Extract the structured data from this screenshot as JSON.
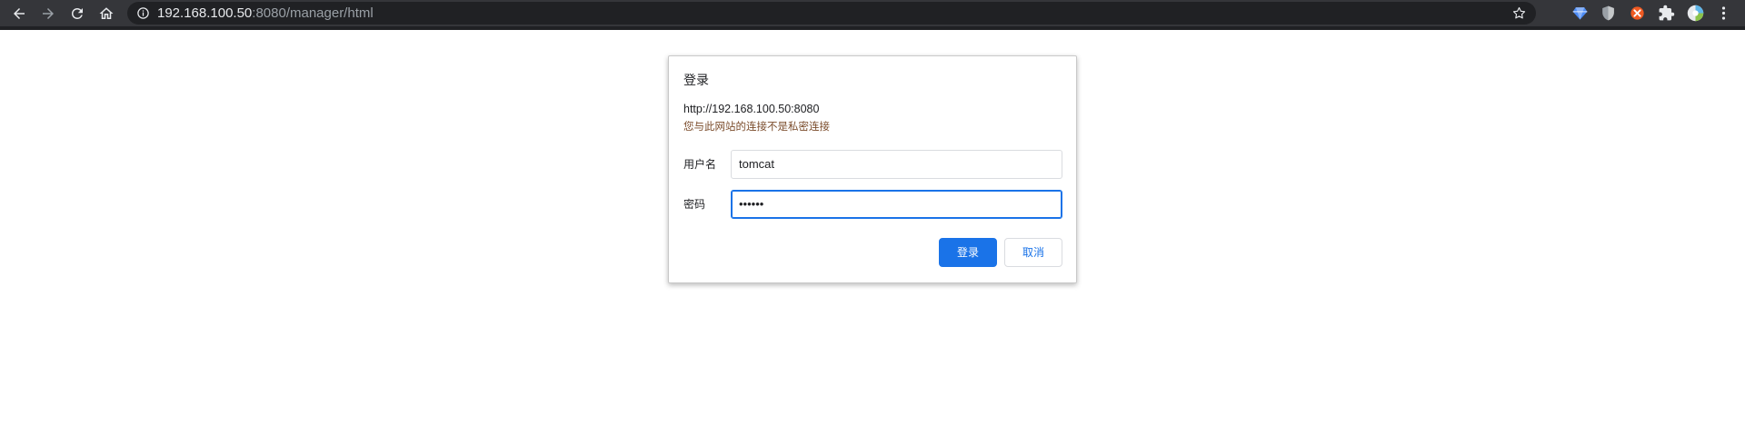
{
  "browser": {
    "url_host": "192.168.100.50",
    "url_rest": ":8080/manager/html"
  },
  "dialog": {
    "title": "登录",
    "origin": "http://192.168.100.50:8080",
    "warning": "您与此网站的连接不是私密连接",
    "username_label": "用户名",
    "username_value": "tomcat",
    "password_label": "密码",
    "password_value": "••••••",
    "login_button": "登录",
    "cancel_button": "取消"
  },
  "colors": {
    "toolbar_bg": "#35363a",
    "primary_button": "#1a73e8",
    "warning_text": "#7a4b2a"
  }
}
